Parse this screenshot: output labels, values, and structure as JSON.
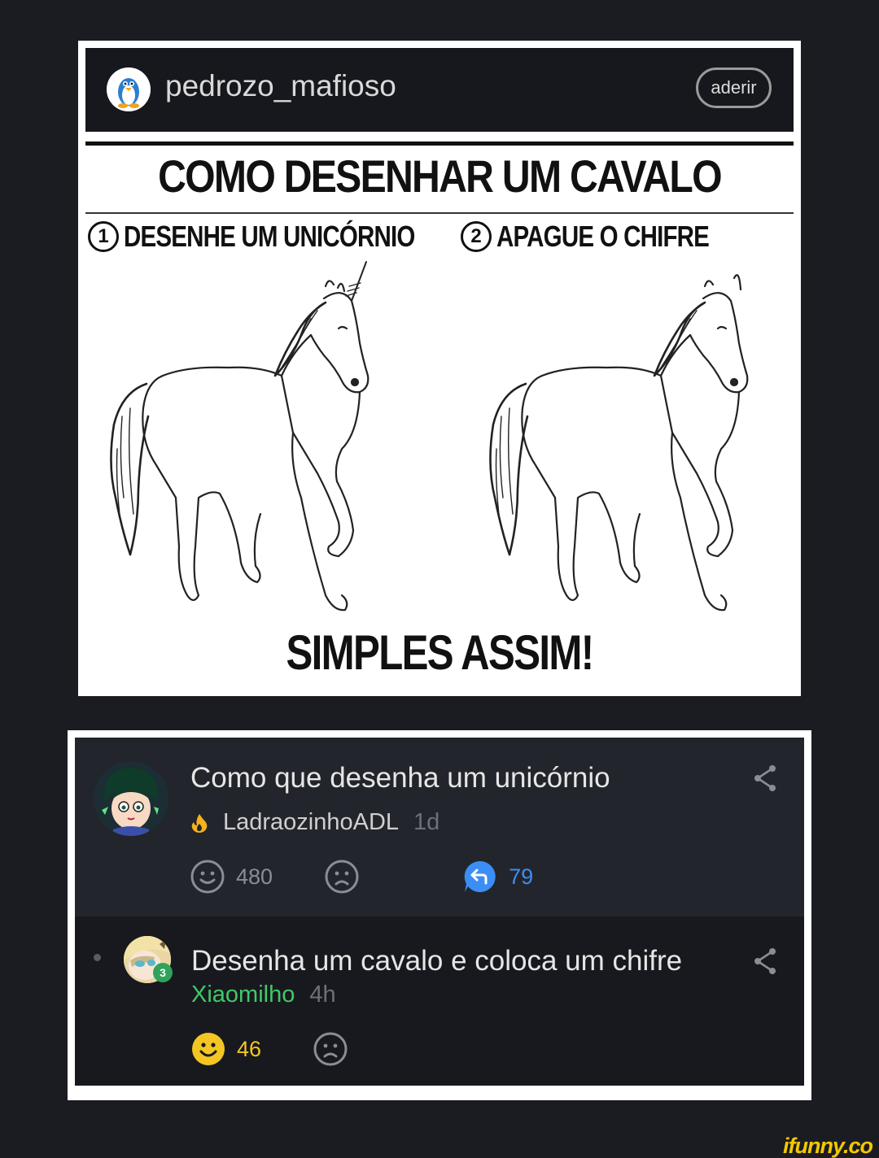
{
  "post": {
    "username": "pedrozo_mafioso",
    "join_label": "aderir",
    "avatar_icon": "penguin-avatar-icon"
  },
  "meme": {
    "title": "COMO DESENHAR UM CAVALO",
    "steps": [
      {
        "num": "1",
        "text": "DESENHE UM UNICÓRNIO"
      },
      {
        "num": "2",
        "text": "APAGUE O CHIFRE"
      }
    ],
    "footer": "SIMPLES ASSIM!"
  },
  "comments": [
    {
      "text": "Como que desenha um unicórnio",
      "author": "LadraozinhoADL",
      "time": "1d",
      "likes": "480",
      "replies": "79",
      "author_color": "#cfcfcf"
    },
    {
      "text": "Desenha um cavalo e coloca um chifre",
      "author": "Xiaomilho",
      "time": "4h",
      "likes": "46",
      "level": "3",
      "author_color": "#41c86a"
    }
  ],
  "watermark": "ifunny.co",
  "colors": {
    "background": "#1b1c22",
    "like_active": "#f3c623",
    "reply_blue": "#3b8ef5",
    "level_green": "#2fa35a"
  }
}
